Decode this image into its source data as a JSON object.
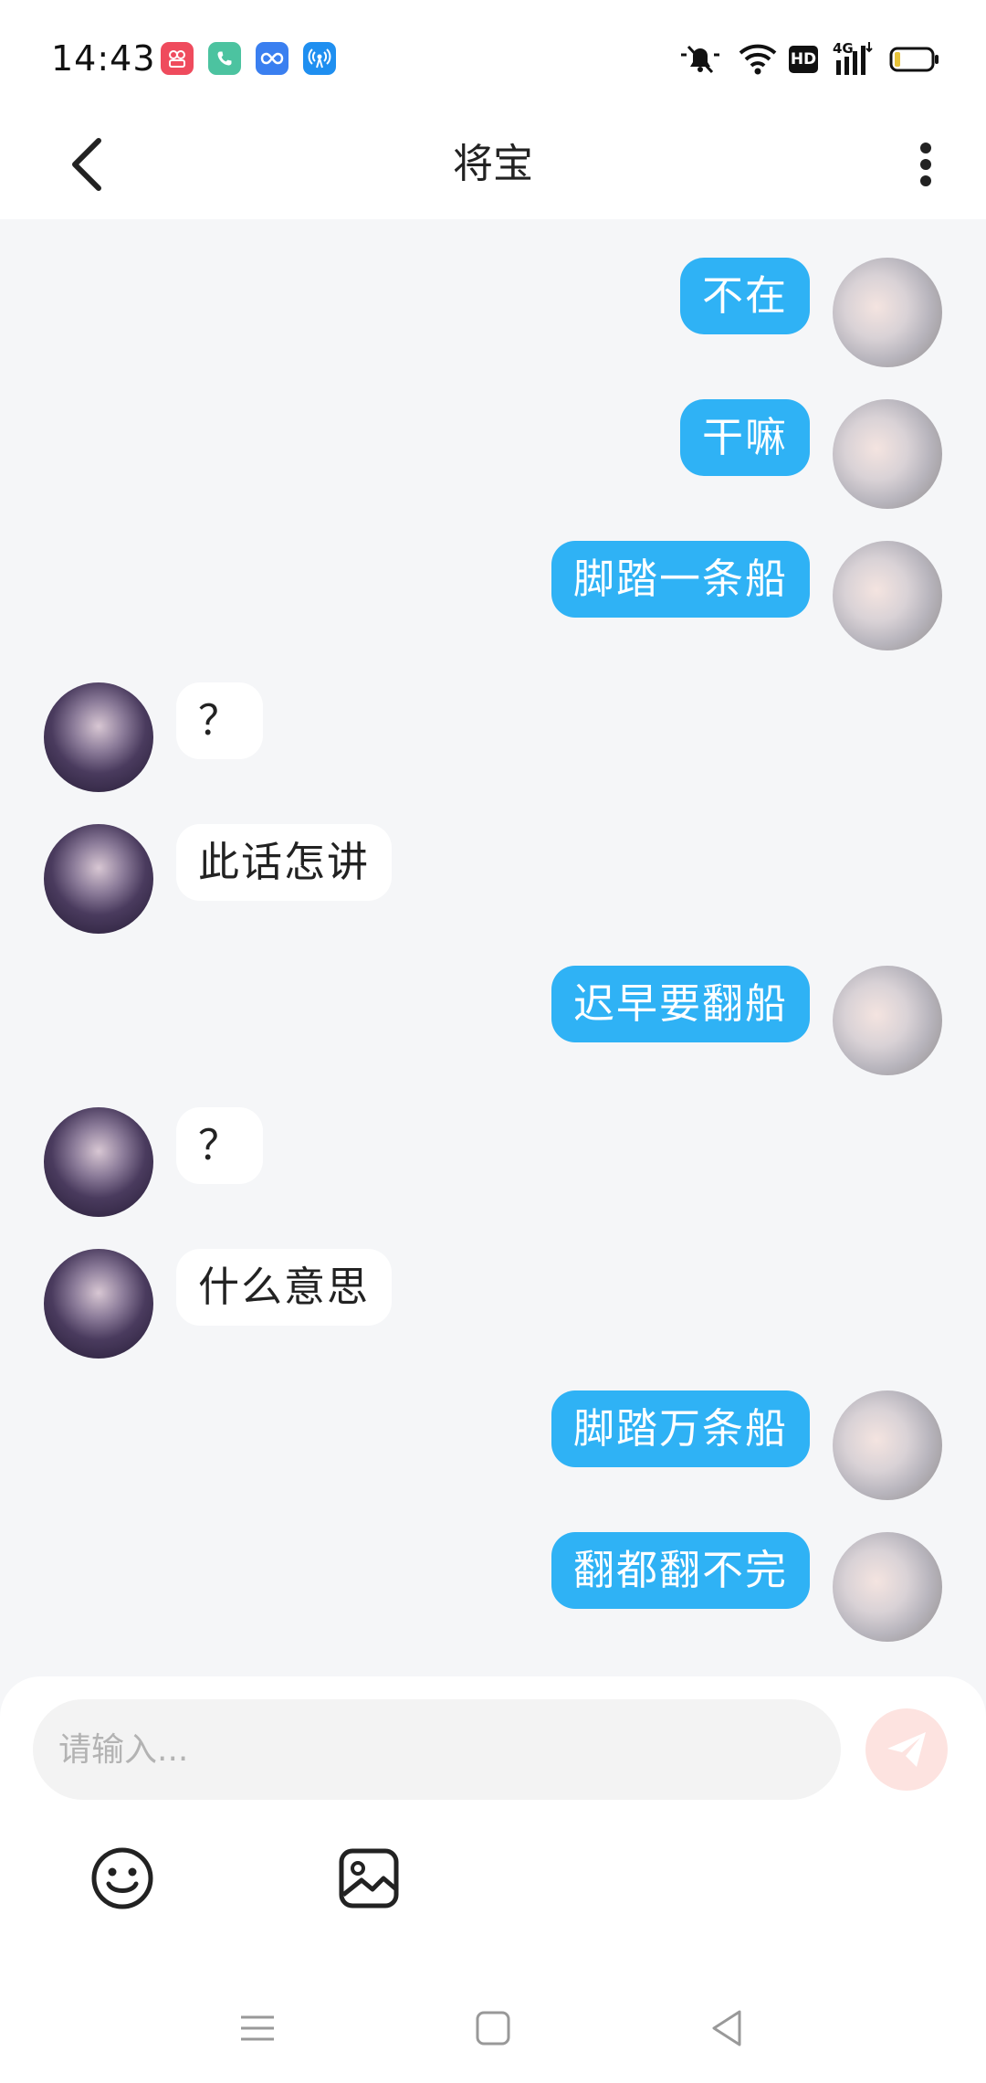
{
  "status_bar": {
    "time": "14:43",
    "app_icons": [
      {
        "name": "video-call-app-icon",
        "color": "#ef4b5d"
      },
      {
        "name": "phone-app-icon",
        "color": "#4cc3a0"
      },
      {
        "name": "infinity-app-icon",
        "color": "#3a7ff0"
      },
      {
        "name": "hotspot-app-icon",
        "color": "#1f8ff0"
      }
    ],
    "network_label": "4G",
    "hd_label": "HD"
  },
  "header": {
    "title": "将宝"
  },
  "messages": [
    {
      "side": "me",
      "text": "不在"
    },
    {
      "side": "me",
      "text": "干嘛"
    },
    {
      "side": "me",
      "text": "脚踏一条船"
    },
    {
      "side": "other",
      "text": "？"
    },
    {
      "side": "other",
      "text": "此话怎讲"
    },
    {
      "side": "me",
      "text": "迟早要翻船"
    },
    {
      "side": "other",
      "text": "？"
    },
    {
      "side": "other",
      "text": "什么意思"
    },
    {
      "side": "me",
      "text": "脚踏万条船"
    },
    {
      "side": "me",
      "text": "翻都翻不完"
    }
  ],
  "composer": {
    "placeholder": "请输入..."
  },
  "colors": {
    "my_bubble": "#2fb2f5",
    "other_bubble": "#ffffff",
    "chat_background": "#f5f6f8",
    "send_button": "#fde3e0"
  }
}
